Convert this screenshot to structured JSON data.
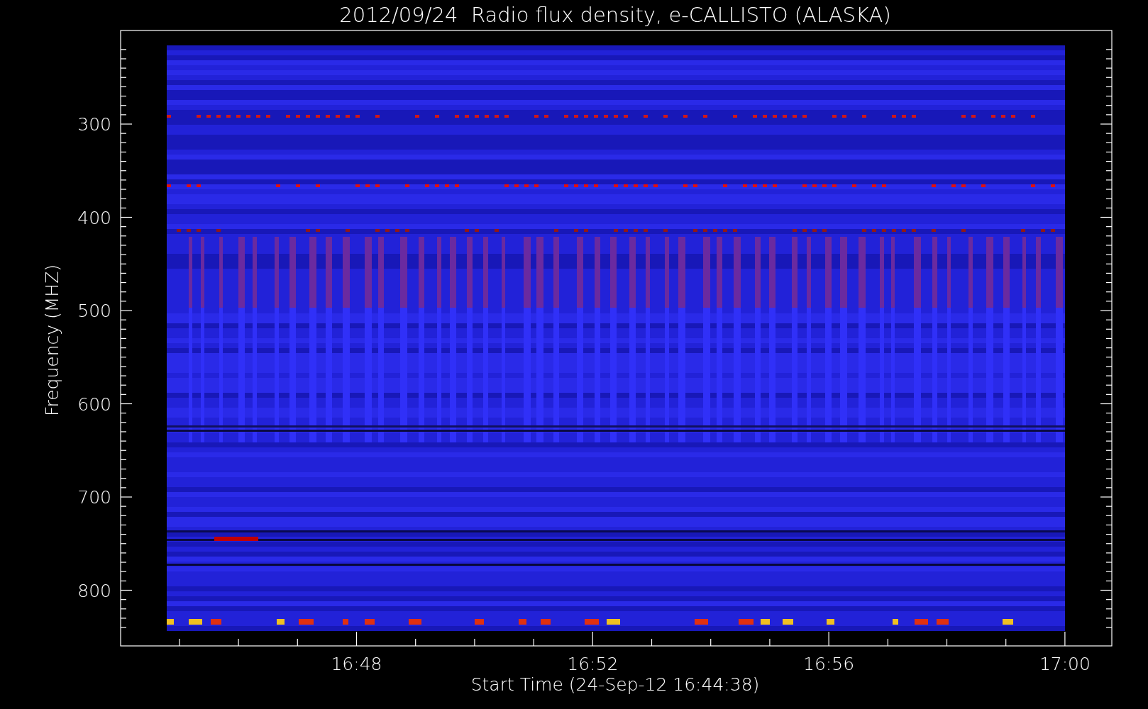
{
  "title": "2012/09/24  Radio flux density, e-CALLISTO (ALASKA)",
  "plot": {
    "ylabel": "Frequency (MHZ)",
    "xlabel": "Start Time (24-Sep-12 16:44:38)",
    "yticks": [
      {
        "label": "300"
      },
      {
        "label": "400"
      },
      {
        "label": "500"
      },
      {
        "label": "600"
      },
      {
        "label": "700"
      },
      {
        "label": "800"
      }
    ],
    "xticks": [
      {
        "label": "16:48"
      },
      {
        "label": "16:52"
      },
      {
        "label": "16:56"
      },
      {
        "label": "17:00"
      }
    ]
  }
}
